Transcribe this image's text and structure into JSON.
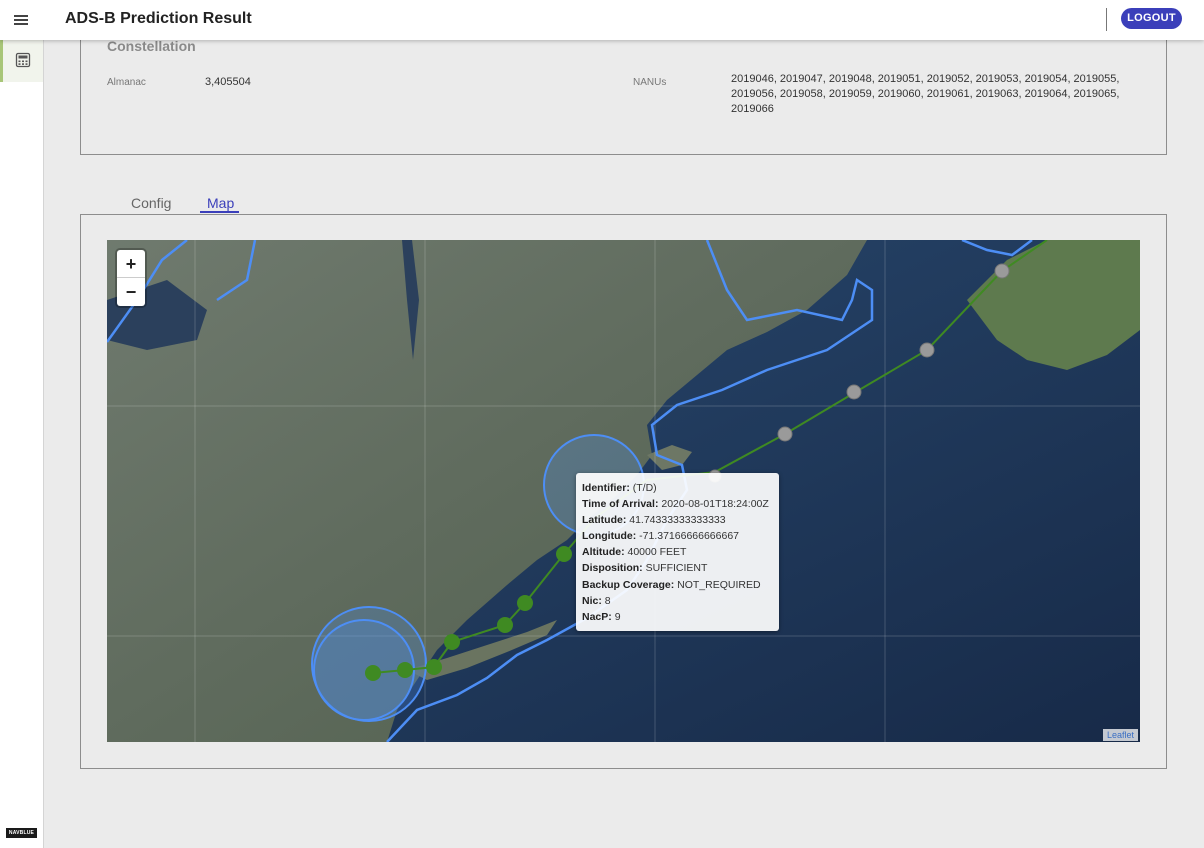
{
  "header": {
    "title": "ADS-B Prediction Result",
    "logout_label": "LOGOUT"
  },
  "sidebar": {
    "brand": "NAVBLUE"
  },
  "constellation": {
    "title": "Constellation",
    "almanac_label": "Almanac",
    "almanac_value": "3,405504",
    "nanus_label": "NANUs",
    "nanus_value": "2019046, 2019047, 2019048, 2019051, 2019052, 2019053, 2019054, 2019055, 2019056, 2019058, 2019059, 2019060, 2019061, 2019063, 2019064, 2019065, 2019066"
  },
  "tabs": [
    {
      "label": "Config",
      "active": false
    },
    {
      "label": "Map",
      "active": true
    }
  ],
  "map": {
    "zoom_in": "+",
    "zoom_out": "−",
    "attribution": "Leaflet",
    "popup": {
      "identifier_label": "Identifier:",
      "identifier": "(T/D)",
      "toa_label": "Time of Arrival:",
      "toa": "2020-08-01T18:24:00Z",
      "lat_label": "Latitude:",
      "lat": "41.74333333333333",
      "lon_label": "Longitude:",
      "lon": "-71.37166666666667",
      "alt_label": "Altitude:",
      "alt": "40000 FEET",
      "disp_label": "Disposition:",
      "disp": "SUFFICIENT",
      "backup_label": "Backup Coverage:",
      "backup": "NOT_REQUIRED",
      "nic_label": "Nic:",
      "nic": "8",
      "nacp_label": "NacP:",
      "nacp": "9"
    }
  },
  "colors": {
    "accent": "#3b3fba",
    "route": "#3f8a22",
    "coverage": "#4d8ef5"
  }
}
